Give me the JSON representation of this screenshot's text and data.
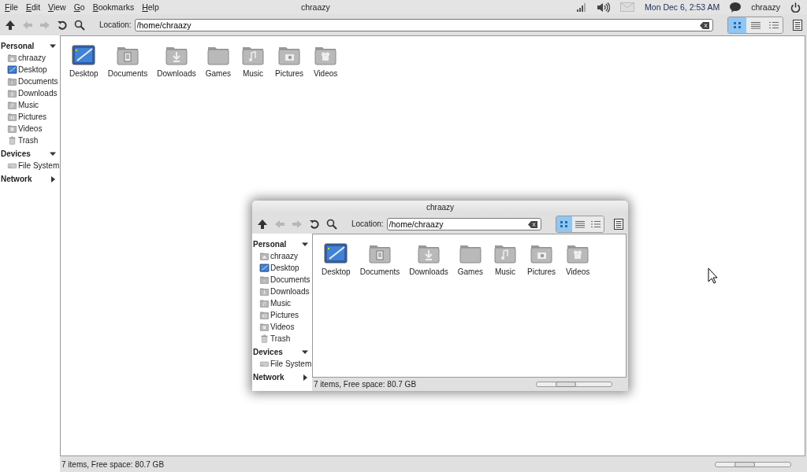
{
  "top_panel": {
    "menu": [
      {
        "label": "File"
      },
      {
        "label": "Edit"
      },
      {
        "label": "View"
      },
      {
        "label": "Go"
      },
      {
        "label": "Bookmarks"
      },
      {
        "label": "Help"
      }
    ],
    "title": "chraazy",
    "clock": "Mon Dec 6, 2:53 AM",
    "user": "chraazy"
  },
  "windows": [
    {
      "location_label": "Location:",
      "location": "/home/chraazy",
      "nav_buttons": [
        {
          "kind": "up",
          "disabled": false
        },
        {
          "kind": "back",
          "disabled": true
        },
        {
          "kind": "forward",
          "disabled": true
        },
        {
          "kind": "reload",
          "disabled": false
        },
        {
          "kind": "search",
          "disabled": false
        }
      ],
      "view_modes": [
        {
          "kind": "icons",
          "selected": true
        },
        {
          "kind": "list",
          "selected": false
        },
        {
          "kind": "compact",
          "selected": false
        }
      ],
      "sidebar": [
        {
          "label": "Personal",
          "expanded": true,
          "items": [
            {
              "label": "chraazy",
              "kind": "home"
            },
            {
              "label": "Desktop",
              "kind": "desktop"
            },
            {
              "label": "Documents",
              "kind": "documents"
            },
            {
              "label": "Downloads",
              "kind": "downloads"
            },
            {
              "label": "Music",
              "kind": "music"
            },
            {
              "label": "Pictures",
              "kind": "pictures"
            },
            {
              "label": "Videos",
              "kind": "videos"
            },
            {
              "label": "Trash",
              "kind": "trash"
            }
          ]
        },
        {
          "label": "Devices",
          "expanded": true,
          "items": [
            {
              "label": "File System",
              "kind": "drive"
            }
          ]
        },
        {
          "label": "Network",
          "expanded": false
        }
      ],
      "files": [
        {
          "label": "Desktop",
          "kind": "desktop"
        },
        {
          "label": "Documents",
          "kind": "documents"
        },
        {
          "label": "Downloads",
          "kind": "downloads"
        },
        {
          "label": "Games",
          "kind": "folder"
        },
        {
          "label": "Music",
          "kind": "music"
        },
        {
          "label": "Pictures",
          "kind": "pictures"
        },
        {
          "label": "Videos",
          "kind": "videos"
        }
      ],
      "status": "7 items, Free space: 80.7 GB",
      "zoom": {
        "level": 0.35
      }
    },
    {
      "title": "chraazy",
      "location_label": "Location:",
      "location": "/home/chraazy",
      "nav_buttons": [
        {
          "kind": "up",
          "disabled": false
        },
        {
          "kind": "back",
          "disabled": true
        },
        {
          "kind": "forward",
          "disabled": true
        },
        {
          "kind": "reload",
          "disabled": false
        },
        {
          "kind": "search",
          "disabled": false
        }
      ],
      "view_modes": [
        {
          "kind": "icons",
          "selected": true
        },
        {
          "kind": "list",
          "selected": false
        },
        {
          "kind": "compact",
          "selected": false
        }
      ],
      "sidebar": [
        {
          "label": "Personal",
          "expanded": true,
          "items": [
            {
              "label": "chraazy",
              "kind": "home"
            },
            {
              "label": "Desktop",
              "kind": "desktop"
            },
            {
              "label": "Documents",
              "kind": "documents"
            },
            {
              "label": "Downloads",
              "kind": "downloads"
            },
            {
              "label": "Music",
              "kind": "music"
            },
            {
              "label": "Pictures",
              "kind": "pictures"
            },
            {
              "label": "Videos",
              "kind": "videos"
            },
            {
              "label": "Trash",
              "kind": "trash"
            }
          ]
        },
        {
          "label": "Devices",
          "expanded": true,
          "items": [
            {
              "label": "File System",
              "kind": "drive"
            }
          ]
        },
        {
          "label": "Network",
          "expanded": false
        }
      ],
      "files": [
        {
          "label": "Desktop",
          "kind": "desktop"
        },
        {
          "label": "Documents",
          "kind": "documents"
        },
        {
          "label": "Downloads",
          "kind": "downloads"
        },
        {
          "label": "Games",
          "kind": "folder"
        },
        {
          "label": "Music",
          "kind": "music"
        },
        {
          "label": "Pictures",
          "kind": "pictures"
        },
        {
          "label": "Videos",
          "kind": "videos"
        }
      ],
      "status": "7 items, Free space: 80.7 GB",
      "zoom": {
        "level": 0.35
      }
    }
  ]
}
